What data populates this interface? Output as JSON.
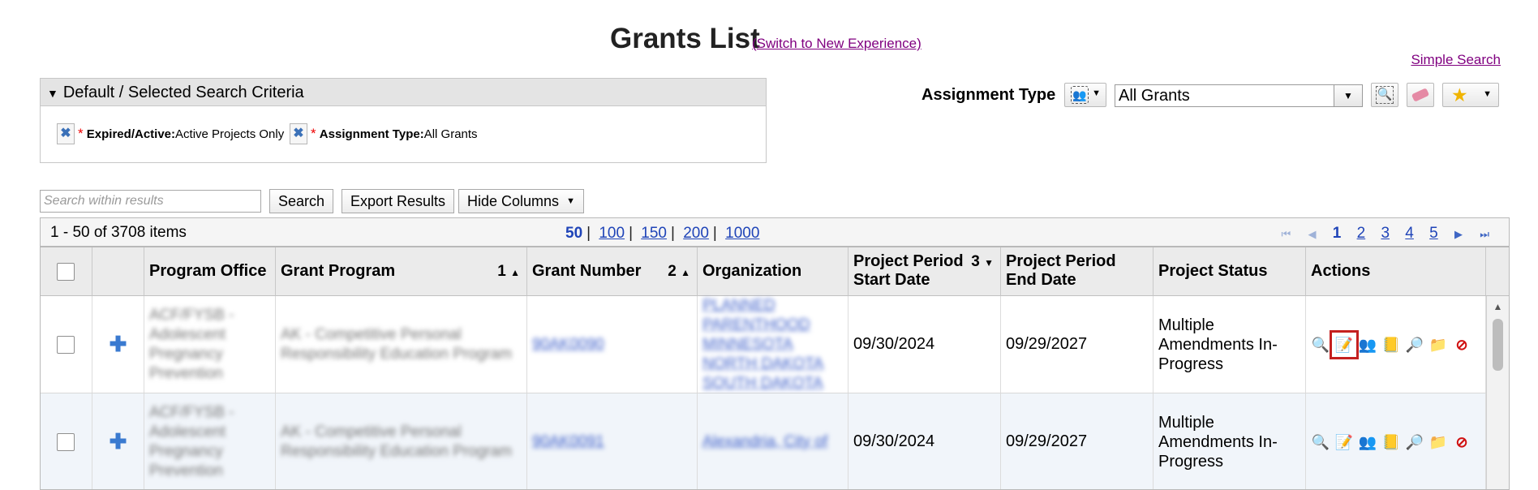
{
  "header": {
    "title": "Grants List",
    "switch_link": "(Switch to New Experience)",
    "simple_search": "Simple Search"
  },
  "criteria": {
    "panel_title": "Default / Selected Search Criteria",
    "items": [
      {
        "label": "Expired/Active:",
        "value": "Active Projects Only"
      },
      {
        "label": "Assignment Type:",
        "value": "All Grants"
      }
    ]
  },
  "assignment": {
    "label": "Assignment Type",
    "selected": "All Grants"
  },
  "search": {
    "placeholder": "Search within results",
    "search_button": "Search",
    "export_button": "Export Results",
    "hide_columns_button": "Hide Columns"
  },
  "pager": {
    "summary": "1 - 50 of 3708 items",
    "page_sizes": [
      "50",
      "100",
      "150",
      "200",
      "1000"
    ],
    "pages": [
      "1",
      "2",
      "3",
      "4",
      "5"
    ]
  },
  "grid": {
    "columns": [
      {
        "label": "Program Office"
      },
      {
        "label": "Grant Program",
        "sort": "1"
      },
      {
        "label": "Grant Number",
        "sort": "2"
      },
      {
        "label": "Organization"
      },
      {
        "label": "Project Period Start Date",
        "sort": "3"
      },
      {
        "label": "Project Period End Date"
      },
      {
        "label": "Project Status"
      },
      {
        "label": "Actions"
      }
    ],
    "rows": [
      {
        "program_office": "ACF/FYSB - Adolescent Pregnancy Prevention",
        "grant_program": "AK - Competitive Personal Responsibility Education Program",
        "grant_number": "90AK0090",
        "organization": "PLANNED PARENTHOOD MINNESOTA NORTH DAKOTA SOUTH DAKOTA",
        "start": "09/30/2024",
        "end": "09/29/2027",
        "status": "Multiple Amendments In-Progress"
      },
      {
        "program_office": "ACF/FYSB - Adolescent Pregnancy Prevention",
        "grant_program": "AK - Competitive Personal Responsibility Education Program",
        "grant_number": "90AK0091",
        "organization": "Alexandria, City of",
        "start": "09/30/2024",
        "end": "09/29/2027",
        "status": "Multiple Amendments In-Progress"
      }
    ]
  },
  "icons": {
    "remove": "remove-criteria-icon",
    "assignment": "person-group-icon",
    "search": "magnifier-icon",
    "clear": "eraser-icon",
    "favorite": "star-icon"
  },
  "colors": {
    "link": "#800080",
    "pager_link": "#1f44b8",
    "highlight": "#c42020",
    "required": "#ee0000"
  }
}
